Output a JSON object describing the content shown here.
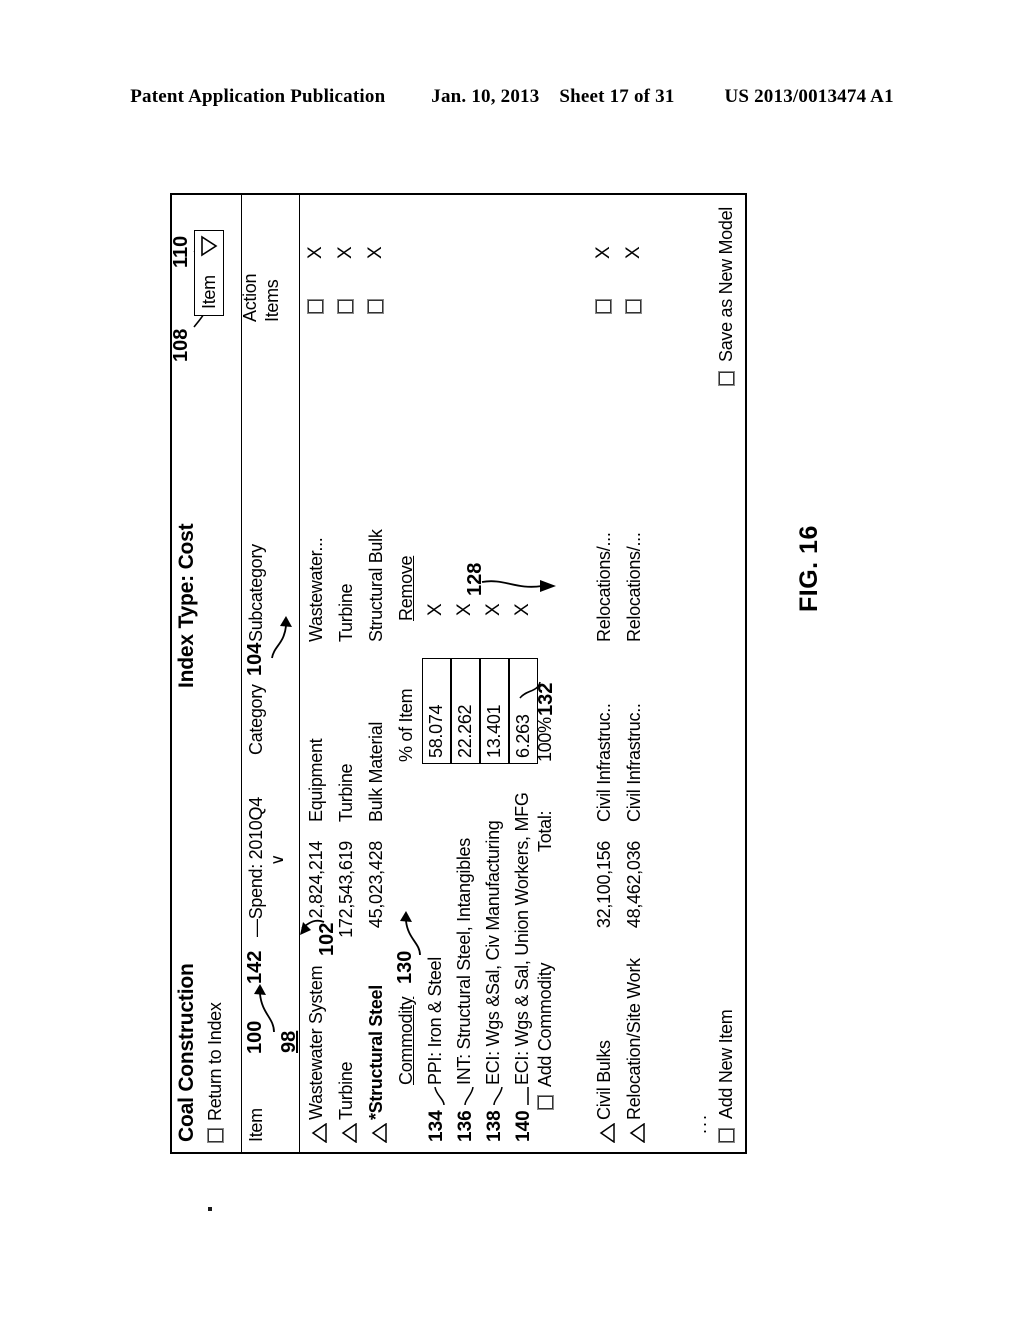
{
  "publication_header": {
    "left": "Patent Application Publication",
    "date": "Jan. 10, 2013",
    "sheet": "Sheet 17 of 31",
    "number": "US 2013/0013474 A1"
  },
  "figure": {
    "label": "FIG. 16"
  },
  "window": {
    "title": "Coal Construction",
    "index_type": "Index Type: Cost",
    "return_link": "Return to Index",
    "item_select_value": "Item",
    "ref_100": "100",
    "ref_108": "108",
    "ref_110": "110",
    "ref_142": "142",
    "ref_104": "104",
    "ref_102": "102",
    "ref_128": "128",
    "ref_130": "130",
    "ref_132": "132",
    "ref_98": "98"
  },
  "columns": {
    "item": "Item",
    "spend": "—Spend: 2010Q4",
    "sort_caret": "∨",
    "category": "Category",
    "subcategory": "Subcategory",
    "action": "Action",
    "action_items": "Items"
  },
  "rows": [
    {
      "name": "Wastewater System",
      "spend": "2,824,214",
      "category": "Equipment",
      "subcategory": "Wastewater...",
      "remove": "X"
    },
    {
      "name": "Turbine",
      "spend": "172,543,619",
      "category": "Turbine",
      "subcategory": "Turbine",
      "remove": "X"
    },
    {
      "name": "*Structural Steel",
      "spend": "45,023,428",
      "category": "Bulk Material",
      "subcategory": "Structural Bulk",
      "remove": "X"
    }
  ],
  "commodity_panel": {
    "header_commodity": "Commodity",
    "header_pct": "% of Item",
    "header_remove": "Remove",
    "rows": [
      {
        "ref": "134",
        "name": "PPI: Iron & Steel",
        "pct": "58.074",
        "remove": "X"
      },
      {
        "ref": "136",
        "name": "INT: Structural Steel, Intangibles",
        "pct": "22.262",
        "remove": "X"
      },
      {
        "ref": "138",
        "name": "ECI: Wgs &Sal, Civ Manufacturing",
        "pct": "13.401",
        "remove": "X"
      },
      {
        "ref": "140",
        "name": "ECI: Wgs & Sal, Union Workers, MFG",
        "pct": "6.263",
        "remove": "X"
      }
    ],
    "add_commodity": "Add Commodity",
    "total_label": "Total:",
    "total_value": "100%"
  },
  "rows_after": [
    {
      "name": "Civil Bulks",
      "spend": "32,100,156",
      "category": "Civil Infrastruc..",
      "subcategory": "Relocations/...",
      "remove": "X"
    },
    {
      "name": "Relocation/Site Work",
      "spend": "48,462,036",
      "category": "Civil Infrastruc..",
      "subcategory": "Relocations/...",
      "remove": "X"
    }
  ],
  "footer": {
    "ellipsis": "...",
    "add_new_item": "Add New Item",
    "save_as_new_model": "Save as New Model"
  }
}
